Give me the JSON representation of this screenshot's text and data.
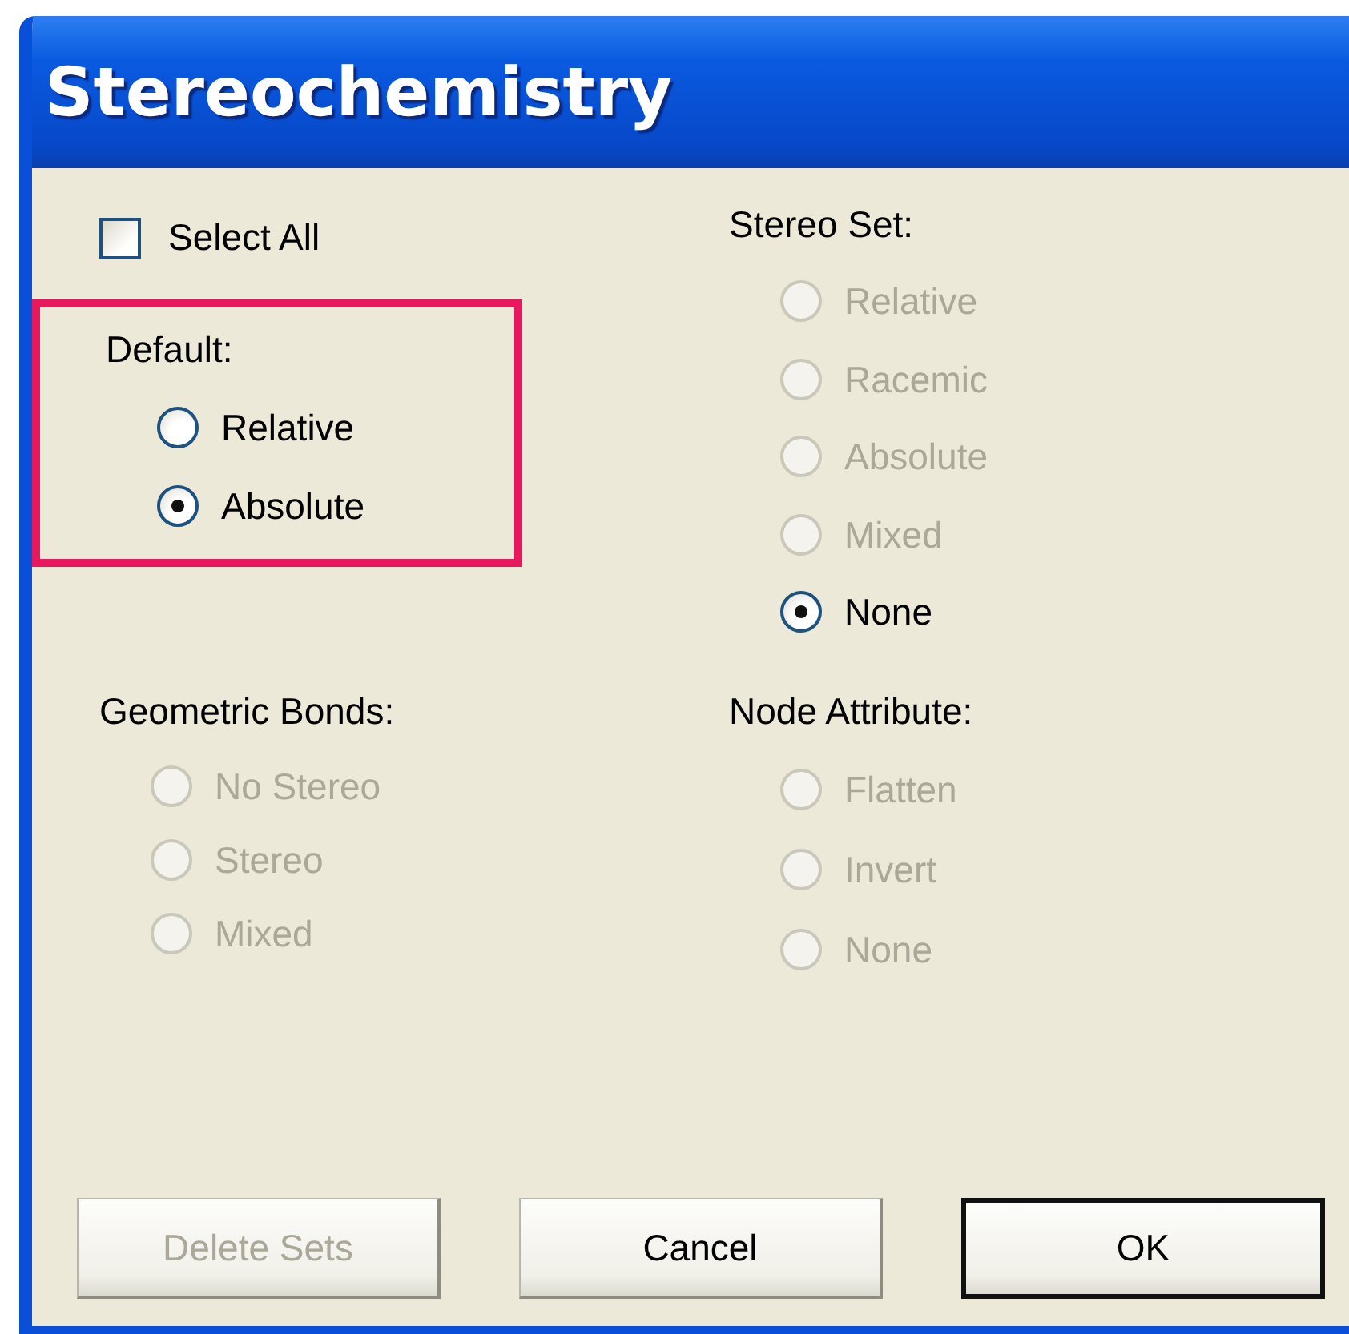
{
  "window": {
    "title": "Stereochemistry"
  },
  "select_all": {
    "label": "Select All",
    "checked": false
  },
  "default_group": {
    "label": "Default:",
    "highlighted": true,
    "options": [
      {
        "label": "Relative",
        "selected": false,
        "disabled": false
      },
      {
        "label": "Absolute",
        "selected": true,
        "disabled": false
      }
    ]
  },
  "stereo_set": {
    "label": "Stereo Set:",
    "options": [
      {
        "label": "Relative",
        "selected": false,
        "disabled": true
      },
      {
        "label": "Racemic",
        "selected": false,
        "disabled": true
      },
      {
        "label": "Absolute",
        "selected": false,
        "disabled": true
      },
      {
        "label": "Mixed",
        "selected": false,
        "disabled": true
      },
      {
        "label": "None",
        "selected": true,
        "disabled": false
      }
    ]
  },
  "geometric_bonds": {
    "label": "Geometric Bonds:",
    "options": [
      {
        "label": "No Stereo",
        "selected": false,
        "disabled": true
      },
      {
        "label": "Stereo",
        "selected": false,
        "disabled": true
      },
      {
        "label": "Mixed",
        "selected": false,
        "disabled": true
      }
    ]
  },
  "node_attribute": {
    "label": "Node Attribute:",
    "options": [
      {
        "label": "Flatten",
        "selected": false,
        "disabled": true
      },
      {
        "label": "Invert",
        "selected": false,
        "disabled": true
      },
      {
        "label": "None",
        "selected": false,
        "disabled": true
      }
    ]
  },
  "buttons": [
    {
      "label": "Delete Sets",
      "disabled": true,
      "default": false
    },
    {
      "label": "Cancel",
      "disabled": false,
      "default": false
    },
    {
      "label": "OK",
      "disabled": false,
      "default": true
    }
  ]
}
